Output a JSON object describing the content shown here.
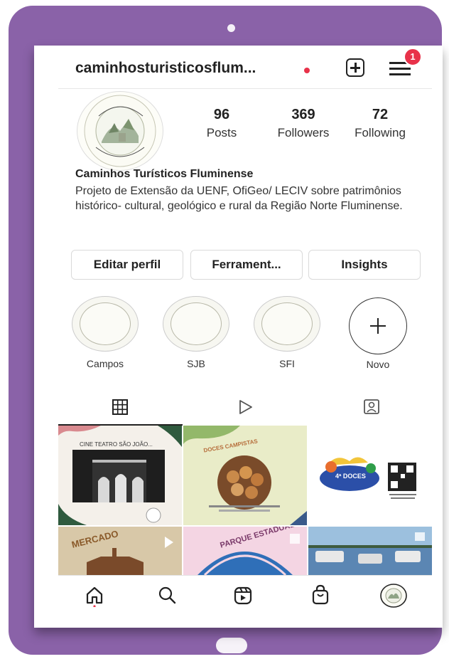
{
  "header": {
    "username": "caminhosturisticosflum...",
    "notification_count": "1"
  },
  "profile": {
    "stats": [
      {
        "value": "96",
        "label": "Posts"
      },
      {
        "value": "369",
        "label": "Followers"
      },
      {
        "value": "72",
        "label": "Following"
      }
    ],
    "name": "Caminhos Turísticos Fluminense",
    "bio": "Projeto de Extensão da UENF, OfiGeo/ LECIV sobre patrimônios histórico- cultural, geológico e rural da Região Norte Fluminense."
  },
  "actions": {
    "edit_profile": "Editar perfil",
    "tools": "Ferrament...",
    "insights": "Insights"
  },
  "highlights": [
    {
      "label": "Campos"
    },
    {
      "label": "SJB"
    },
    {
      "label": "SFI"
    },
    {
      "label": "Novo"
    }
  ],
  "posts": [
    {
      "title": "CINE TEATRO SÃO JOÃO..."
    },
    {
      "title": "DOCES CAMPISTAS"
    },
    {
      "title": "4ª DOCES"
    },
    {
      "title": "MERCADO"
    },
    {
      "title": "PARQUE ESTADUAL"
    },
    {
      "title": ""
    }
  ],
  "colors": {
    "tablet_frame": "#8a62a8",
    "notification": "#e8324a"
  },
  "icons": {
    "header": [
      "plus-square-icon",
      "menu-icon"
    ],
    "tabs": [
      "grid-icon",
      "reels-icon",
      "tagged-icon"
    ],
    "nav": [
      "home-icon",
      "search-icon",
      "reels-icon",
      "shop-icon",
      "profile-icon"
    ]
  }
}
